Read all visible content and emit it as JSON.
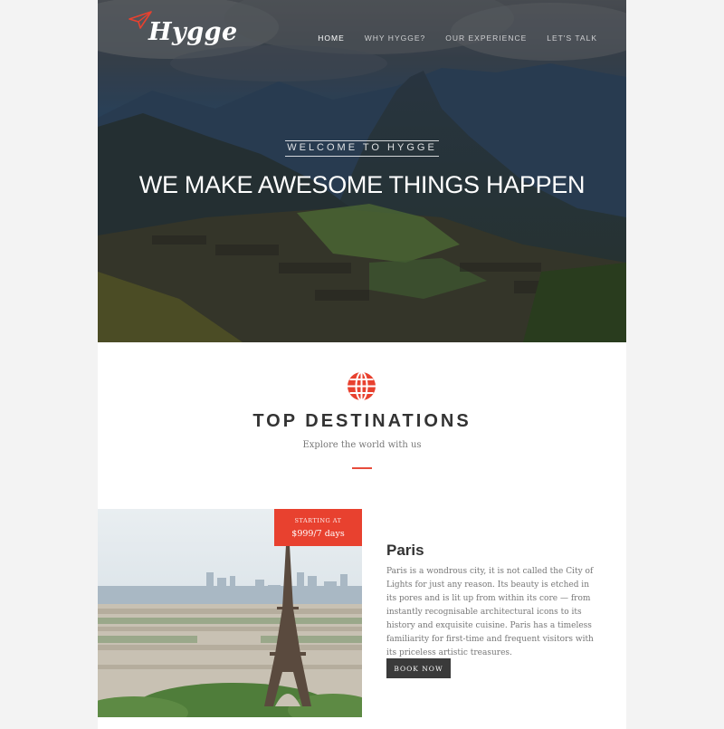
{
  "brand": {
    "logo_text": "Hygge"
  },
  "nav": {
    "items": [
      {
        "label": "HOME"
      },
      {
        "label": "WHY HYGGE?"
      },
      {
        "label": "OUR EXPERIENCE"
      },
      {
        "label": "LET'S TALK"
      }
    ]
  },
  "hero": {
    "welcome": "WELCOME TO HYGGE",
    "title": "WE MAKE AWESOME THINGS HAPPEN"
  },
  "destinations": {
    "icon": "globe-icon",
    "title": "TOP DESTINATIONS",
    "subtitle": "Explore the world with us"
  },
  "card": {
    "price_label": "STARTING AT",
    "price_value": "$999/7 days",
    "city": "Paris",
    "description": "Paris is a wondrous city, it is not called the City of Lights for just any reason. Its beauty is etched in its pores and is lit up from within its core — from instantly recognisable architectural icons to its history and exquisite cuisine. Paris has a timeless familiarity for first-time and frequent visitors with its priceless artistic treasures.",
    "button": "BOOK NOW"
  },
  "colors": {
    "accent": "#e8412f",
    "button_bg": "#3a3a3a",
    "page_bg": "#f3f3f3"
  }
}
